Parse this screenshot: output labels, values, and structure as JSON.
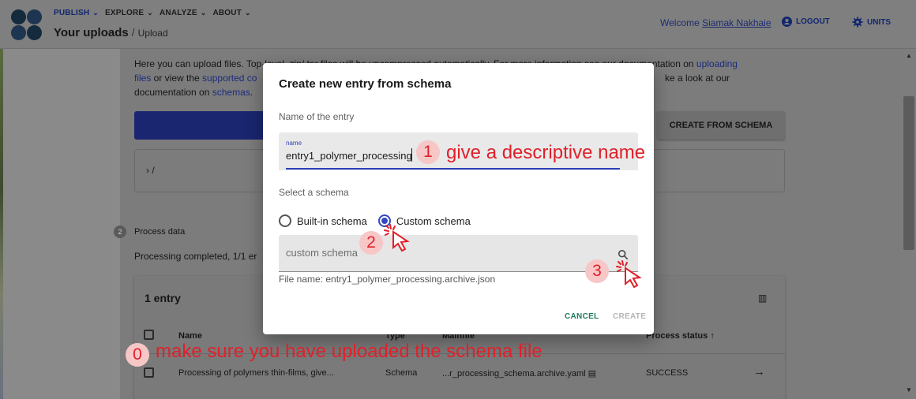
{
  "header": {
    "nav": [
      {
        "label": "PUBLISH",
        "active": true
      },
      {
        "label": "EXPLORE",
        "active": false
      },
      {
        "label": "ANALYZE",
        "active": false
      },
      {
        "label": "ABOUT",
        "active": false
      }
    ],
    "breadcrumb": {
      "root": "Your uploads",
      "separator": "/",
      "current": "Upload"
    },
    "welcome_prefix": "Welcome",
    "user_name": "Siamak Nakhaie",
    "logout_label": "LOGOUT",
    "units_label": "UNITS"
  },
  "page": {
    "intro_line1_a": "Here you can upload files. Top-level .zip/.tar files will be uncompressed automatically. For more information see our documentation on ",
    "intro_line1_link": "uploading",
    "intro_line2_link": "files",
    "intro_line2_a": " or view the ",
    "intro_line2_link2": "supported co",
    "intro_line2_b": "ke a look at our",
    "intro_line3_a": "documentation on ",
    "intro_line3_link": "schemas",
    "intro_line3_b": ".",
    "create_from_schema_label": "CREATE FROM SCHEMA",
    "path": "› /",
    "step2_number": "2",
    "step2_label": "Process data",
    "processing_text": "Processing completed, 1/1 er",
    "table": {
      "count": "1 entry",
      "headers": [
        "Name",
        "Type",
        "Mainfile",
        "Process status ↑"
      ],
      "row": {
        "name": "Processing of polymers thin-films, give...",
        "type": "Schema",
        "mainfile": "...r_processing_schema.archive.yaml",
        "status": "SUCCESS"
      }
    }
  },
  "dialog": {
    "title": "Create new entry from schema",
    "name_section_label": "Name of the entry",
    "name_field_label": "name",
    "name_value": "entry1_polymer_processing",
    "schema_section_label": "Select a schema",
    "radio_builtin": "Built-in schema",
    "radio_custom": "Custom schema",
    "custom_placeholder": "custom schema",
    "file_name_note": "File name: entry1_polymer_processing.archive.json",
    "cancel_label": "CANCEL",
    "create_label": "CREATE"
  },
  "annotations": {
    "n0": "0",
    "t0": "make sure you have uploaded the schema file",
    "n1": "1",
    "t1": "give a descriptive name",
    "n2": "2",
    "n3": "3"
  },
  "colors": {
    "accent": "#3347c4",
    "annotation": "#e0202a",
    "annotation_bg": "#f7c7c7",
    "cancel": "#1e7a5a"
  }
}
